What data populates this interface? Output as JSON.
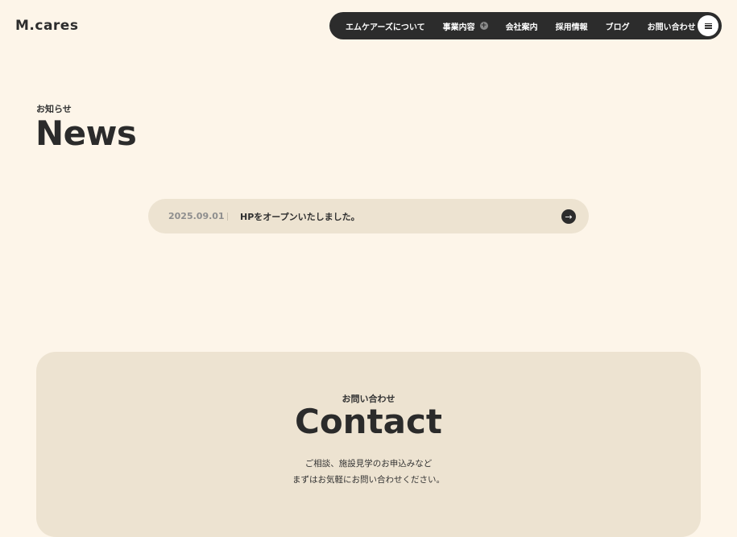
{
  "header": {
    "logo": "M.cares",
    "nav": [
      {
        "label": "エムケアーズについて"
      },
      {
        "label": "事業内容",
        "has_plus": true
      },
      {
        "label": "会社案内"
      },
      {
        "label": "採用情報"
      },
      {
        "label": "ブログ"
      },
      {
        "label": "お問い合わせ"
      }
    ],
    "menu_icon": "hamburger-icon"
  },
  "news": {
    "subtitle": "お知らせ",
    "title": "News",
    "items": [
      {
        "date": "2025.09.01",
        "text": "HPをオープンいたしました。"
      }
    ]
  },
  "contact": {
    "subtitle": "お問い合わせ",
    "title": "Contact",
    "line1": "ご相談、施設見学のお申込みなど",
    "line2": "まずはお気軽にお問い合わせください。"
  },
  "colors": {
    "background": "#fdf5e9",
    "card": "#ede3d1",
    "dark": "#2c2c2c"
  }
}
